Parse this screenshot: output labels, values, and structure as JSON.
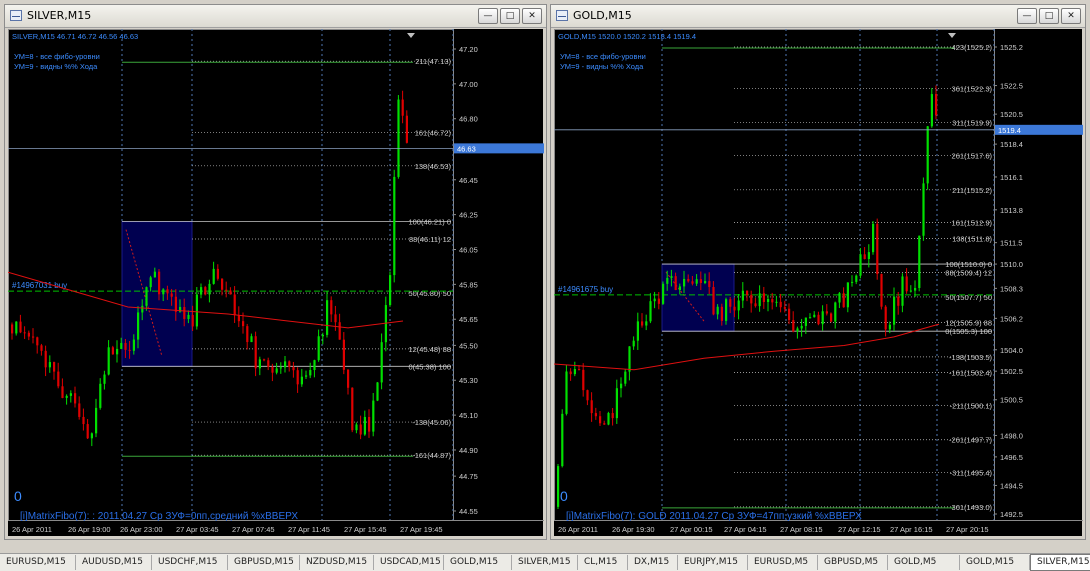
{
  "windows": [
    {
      "title": "SILVER,M15",
      "header": "SILVER,M15  46.71 46.72 46.56 46.63",
      "info": [
        "УМ=8 - все фибо-уровни",
        "УМ=9 - видны %% Хода"
      ],
      "price_labels": [
        "47.20",
        "47.00",
        "46.80",
        "46.45",
        "46.25",
        "46.05",
        "45.85",
        "45.65",
        "45.50",
        "45.30",
        "45.10",
        "44.90",
        "44.75",
        "44.55"
      ],
      "price_values": [
        47.2,
        47.0,
        46.8,
        46.45,
        46.25,
        46.05,
        45.85,
        45.65,
        45.5,
        45.3,
        45.1,
        44.9,
        44.75,
        44.55
      ],
      "current_price": "46.63",
      "fibo": [
        {
          "label": "211(47.13)",
          "value": 47.13
        },
        {
          "label": "161(46.72)",
          "value": 46.72
        },
        {
          "label": "138(46.53)",
          "value": 46.53
        },
        {
          "label": "100(46.21) 0",
          "value": 46.21
        },
        {
          "label": "88(46.11) 12",
          "value": 46.11
        },
        {
          "label": "50(45.80) 50",
          "value": 45.8
        },
        {
          "label": "12(45.48) 88",
          "value": 45.48
        },
        {
          "label": "0(45.38) 100",
          "value": 45.38
        },
        {
          "label": "-138(45.06)",
          "value": 45.06
        },
        {
          "label": "-161(44.87)",
          "value": 44.87
        }
      ],
      "order_label": "#14967031 buy",
      "time_labels": [
        "26 Apr 2011",
        "26 Apr 19:00",
        "26 Apr 23:00",
        "27 Apr 03:45",
        "27 Apr 07:45",
        "27 Apr 11:45",
        "27 Apr 15:45",
        "27 Apr 19:45"
      ],
      "zero_mark": "0",
      "indicator_text": "[i]MatrixFibo(7):  : 2011.04.27 Ср ЗУФ=0пп,средний %хВВЕРХ"
    },
    {
      "title": "GOLD,M15",
      "header": "GOLD,M15  1520.0 1520.2 1518.4 1519.4",
      "info": [
        "УМ=8 - все фибо-уровни",
        "УМ=9 - видны %% Хода"
      ],
      "price_labels": [
        "1525.2",
        "1522.5",
        "1520.5",
        "1518.4",
        "1516.1",
        "1513.8",
        "1511.5",
        "1510.0",
        "1508.3",
        "1506.2",
        "1504.0",
        "1502.5",
        "1500.5",
        "1498.0",
        "1496.5",
        "1494.5",
        "1492.5"
      ],
      "price_values": [
        1525.2,
        1522.5,
        1520.5,
        1518.4,
        1516.1,
        1513.8,
        1511.5,
        1510.0,
        1508.3,
        1506.2,
        1504.0,
        1502.5,
        1500.5,
        1498.0,
        1496.5,
        1494.5,
        1492.5
      ],
      "current_price": "1519.4",
      "fibo": [
        {
          "label": "423(1525.2)",
          "value": 1525.2
        },
        {
          "label": "361(1522.3)",
          "value": 1522.3
        },
        {
          "label": "311(1519.9)",
          "value": 1519.9
        },
        {
          "label": "261(1517.6)",
          "value": 1517.6
        },
        {
          "label": "211(1515.2)",
          "value": 1515.2
        },
        {
          "label": "161(1512.9)",
          "value": 1512.9
        },
        {
          "label": "138(1511.8)",
          "value": 1511.8
        },
        {
          "label": "100(1510.0) 0",
          "value": 1510.0
        },
        {
          "label": "88(1509.4) 12",
          "value": 1509.4
        },
        {
          "label": "50(1507.7) 50",
          "value": 1507.7
        },
        {
          "label": "12(1505.9) 88",
          "value": 1505.9
        },
        {
          "label": "0(1505.3) 100",
          "value": 1505.3
        },
        {
          "label": "-138(1503.5)",
          "value": 1503.5
        },
        {
          "label": "-161(1502.4)",
          "value": 1502.4
        },
        {
          "label": "-211(1500.1)",
          "value": 1500.1
        },
        {
          "label": "-261(1497.7)",
          "value": 1497.7
        },
        {
          "label": "-311(1495.4)",
          "value": 1495.4
        },
        {
          "label": "-361(1493.0)",
          "value": 1493.0
        }
      ],
      "order_label": "#14961675 buy",
      "time_labels": [
        "26 Apr 2011",
        "26 Apr 19:30",
        "27 Apr 00:15",
        "27 Apr 04:15",
        "27 Apr 08:15",
        "27 Apr 12:15",
        "27 Apr 16:15",
        "27 Apr 20:15"
      ],
      "zero_mark": "0",
      "indicator_text": "[i]MatrixFibo(7): GOLD 2011.04.27 Ср ЗУФ=47пп,узкий %хВВЕРХ"
    }
  ],
  "tabs": [
    "EURUSD,M15",
    "AUDUSD,M15",
    "USDCHF,M15",
    "GBPUSD,M15",
    "NZDUSD,M15",
    "USDCAD,M15",
    "GOLD,M15",
    "SILVER,M15",
    "CL,M15",
    "DX,M15",
    "EURJPY,M15",
    "EURUSD,M5",
    "GBPUSD,M5",
    "GOLD,M5",
    "GOLD,M15",
    "SILVER,M15"
  ],
  "active_tab": 15,
  "colors": {
    "bull": "#00e000",
    "bear": "#e00000",
    "fibo": "#c8c8c8",
    "grid": "#5078b4",
    "info": "#3c8cff",
    "order": "#00c000",
    "ma": "#e01010",
    "box": "#000050"
  }
}
